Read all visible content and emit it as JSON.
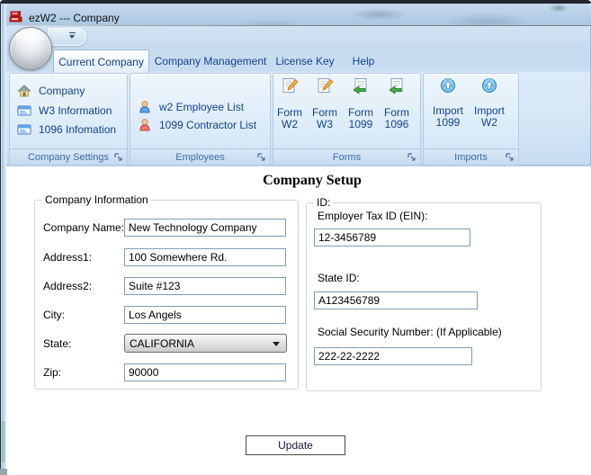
{
  "window": {
    "title": "ezW2 --- Company"
  },
  "tabs": {
    "current_company": "Current Company",
    "company_management": "Company Management",
    "license_key": "License Key",
    "help": "Help"
  },
  "ribbon": {
    "company_settings": {
      "label": "Company Settings",
      "items": {
        "company": "Company",
        "w3": "W3 Information",
        "i1096": "1096 Infomation"
      }
    },
    "employees": {
      "label": "Employees",
      "items": {
        "w2list": "w2 Employee List",
        "c1099": "1099 Contractor List"
      }
    },
    "forms": {
      "label": "Forms",
      "items": {
        "w2": {
          "l1": "Form",
          "l2": "W2"
        },
        "w3": {
          "l1": "Form",
          "l2": "W3"
        },
        "f1099": {
          "l1": "Form",
          "l2": "1099"
        },
        "f1096": {
          "l1": "Form",
          "l2": "1096"
        }
      }
    },
    "imports": {
      "label": "Imports",
      "items": {
        "i1099": {
          "l1": "Import",
          "l2": "1099"
        },
        "iw2": {
          "l1": "Import",
          "l2": "W2"
        }
      }
    }
  },
  "content": {
    "heading": "Company Setup",
    "company_info": {
      "legend": "Company Information",
      "company_name": {
        "label": "Company Name:",
        "value": "New Technology Company"
      },
      "address1": {
        "label": "Address1:",
        "value": "100 Somewhere Rd."
      },
      "address2": {
        "label": "Address2:",
        "value": "Suite #123"
      },
      "city": {
        "label": "City:",
        "value": "Los Angels"
      },
      "state": {
        "label": "State:",
        "value": "CALIFORNIA"
      },
      "zip": {
        "label": "Zip:",
        "value": "90000"
      }
    },
    "ids": {
      "legend": "ID:",
      "ein": {
        "label": "Employer Tax ID (EIN):",
        "value": "12-3456789"
      },
      "state_id": {
        "label": "State ID:",
        "value": "A123456789"
      },
      "ssn": {
        "label": "Social Security Number: (If Applicable)",
        "value": "222-22-2222"
      }
    },
    "update_button": "Update"
  },
  "colors": {
    "accent_text": "#15428b",
    "titlebar_blue": "#aac7e3",
    "ribbon_bg": "#d4e6f6",
    "input_border": "#7f9db9",
    "app_icon_red": "#d42a22"
  }
}
